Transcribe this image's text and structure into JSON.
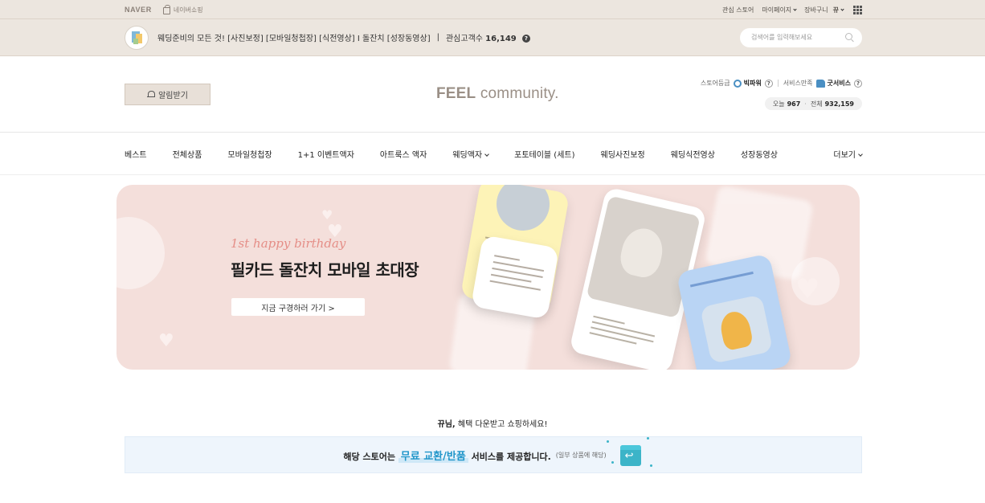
{
  "topbar": {
    "naver_logo": "NAVER",
    "naver_shopping": "네이버쇼핑",
    "links": [
      "관심 스토어",
      "마이페이지",
      "장바구니",
      "뀨"
    ]
  },
  "store": {
    "description": "웨딩준비의 모든 것! [사진보정] [모바일청첩장] [식전영상] I 돌잔치 [성장동영상]",
    "separator": "|",
    "fans_label": "관심고객수",
    "fans_count": "16,149",
    "help": "?",
    "search_placeholder": "검색어를 입력해보세요"
  },
  "header": {
    "alarm_label": "알림받기",
    "logo_bold": "FEEL",
    "logo_light": " community.",
    "grade_label": "스토어등급",
    "grade_value": "빅파워",
    "service_label": "서비스만족",
    "service_value": "굿서비스",
    "help": "?",
    "today_label": "오늘",
    "today_value": "967",
    "dot": "·",
    "total_label": "전체",
    "total_value": "932,159"
  },
  "nav": {
    "items": [
      "베스트",
      "전체상품",
      "모바일청첩장",
      "1+1 이벤트액자",
      "아트룩스 액자",
      "웨딩액자",
      "포토테이블 (세트)",
      "웨딩사진보정",
      "웨딩식전영상",
      "성장동영상"
    ],
    "more": "더보기"
  },
  "banner": {
    "subtitle": "1st happy birthday",
    "title": "필카드 돌잔치 모바일 초대장",
    "cta": "지금 구경하러 가기 >"
  },
  "benefit": {
    "user": "뀨님,",
    "message": " 혜택 다운받고 쇼핑하세요!"
  },
  "return_service": {
    "prefix": "해당 스토어는 ",
    "highlight": "무료 교환/반품",
    "suffix": " 서비스를 제공합니다.",
    "note": "(일부 상품에 해당)"
  },
  "colors": {
    "top_bg": "#ece6df",
    "banner_bg": "#f4dfdb",
    "accent_blue": "#1f95c9",
    "return_bg": "#eef5fc"
  }
}
